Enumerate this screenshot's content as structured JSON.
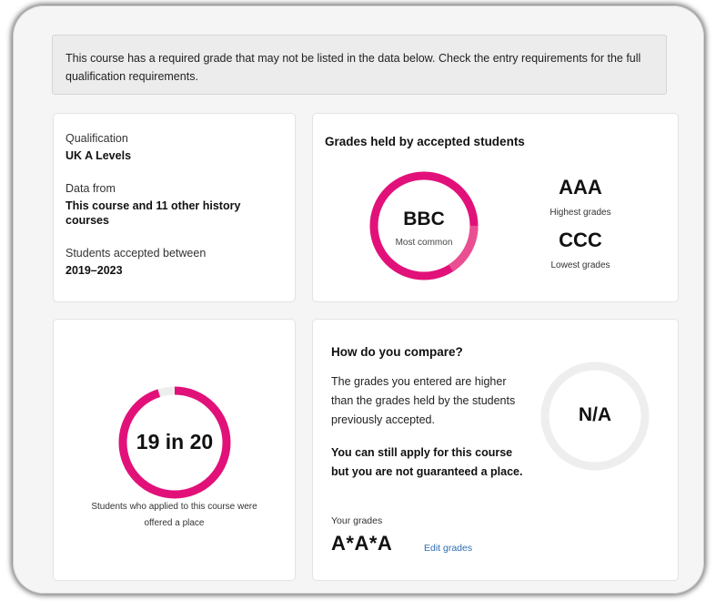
{
  "notice": {
    "text": "This course has a required grade that may not be listed in the data below. Check the entry requirements for the full qualification requirements."
  },
  "qualification_card": {
    "qualification_label": "Qualification",
    "qualification_value": "UK A Levels",
    "data_from_label": "Data from",
    "data_from_value": "This course and 11 other history courses",
    "accepted_label": "Students accepted between",
    "accepted_value": "2019–2023"
  },
  "grades_card": {
    "title": "Grades held by accepted students",
    "most_common_value": "BBC",
    "most_common_label": "Most common",
    "highest_value": "AAA",
    "highest_label": "Highest grades",
    "lowest_value": "CCC",
    "lowest_label": "Lowest grades"
  },
  "offer_card": {
    "ratio_text": "19 in 20",
    "caption": "Students who applied to this course were offered a place",
    "offer_fraction": 0.95
  },
  "compare_card": {
    "title": "How do you compare?",
    "body_text": "The grades you entered are higher than the grades held by the students previously accepted.",
    "bold_text": "You can still apply for this course but you are not guaranteed a place.",
    "your_grades_label": "Your grades",
    "your_grades_value": "A*A*A",
    "edit_link": "Edit grades",
    "comparison_value": "N/A"
  },
  "colors": {
    "accent": "#e2117a",
    "accent_light": "#ea4f92",
    "ring_empty": "#eeeeee",
    "link": "#2f6db5"
  }
}
